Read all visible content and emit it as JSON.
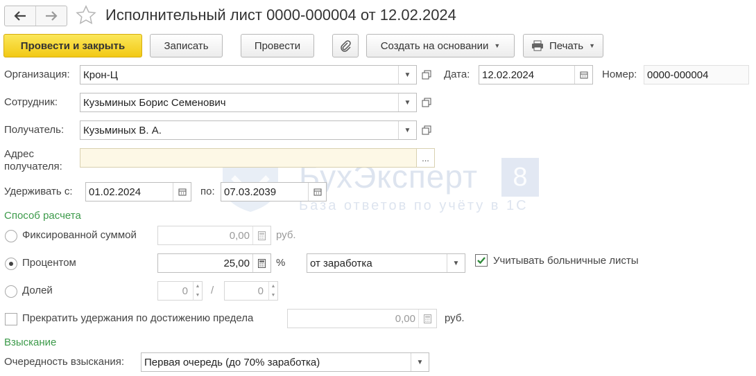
{
  "window": {
    "title": "Исполнительный лист 0000-000004 от 12.02.2024",
    "nav_back_icon": "arrow-left-icon",
    "nav_forward_icon": "arrow-right-icon",
    "favorite_icon": "star-icon"
  },
  "toolbar": {
    "post_close_label": "Провести и закрыть",
    "save_label": "Записать",
    "post_label": "Провести",
    "attach_icon": "paperclip-icon",
    "create_based_label": "Создать на основании",
    "print_label": "Печать",
    "print_icon": "printer-icon"
  },
  "form": {
    "organization": {
      "label": "Организация:",
      "value": "Крон-Ц"
    },
    "date": {
      "label": "Дата:",
      "value": "12.02.2024"
    },
    "number": {
      "label": "Номер:",
      "value": "0000-000004"
    },
    "employee": {
      "label": "Сотрудник:",
      "value": "Кузьминых Борис Семенович"
    },
    "recipient": {
      "label": "Получатель:",
      "value": "Кузьминых В. А."
    },
    "recipient_address": {
      "label_line1": "Адрес",
      "label_line2": "получателя:",
      "value": "",
      "button": "..."
    },
    "withhold_from": {
      "label": "Удерживать с:",
      "value": "01.02.2024"
    },
    "withhold_to": {
      "label": "по:",
      "value": "07.03.2039"
    }
  },
  "calc_method": {
    "section_title": "Способ расчета",
    "fixed": {
      "label": "Фиксированной суммой",
      "value": "0,00",
      "unit": "руб.",
      "selected": false
    },
    "percent": {
      "label": "Процентом",
      "value": "25,00",
      "unit": "%",
      "base": "от заработка",
      "selected": true
    },
    "share": {
      "label": "Долей",
      "numerator": "0",
      "separator": "/",
      "denominator": "0",
      "selected": false
    },
    "consider_sick_leave": {
      "label": "Учитывать больничные листы",
      "checked": true
    },
    "stop_at_limit": {
      "label": "Прекратить удержания по достижению предела",
      "value": "0,00",
      "unit": "руб.",
      "checked": false
    }
  },
  "collection": {
    "section_title": "Взыскание",
    "priority": {
      "label": "Очередность взыскания:",
      "value": "Первая очередь (до 70% заработка)"
    }
  },
  "watermark": {
    "brand": "БухЭксперт",
    "badge": "8",
    "subtitle": "База ответов по учёту в 1С"
  },
  "colors": {
    "primary_button": "#f5d22a",
    "section_title": "#3c9a4a",
    "address_field_bg": "#fdf8e6"
  }
}
